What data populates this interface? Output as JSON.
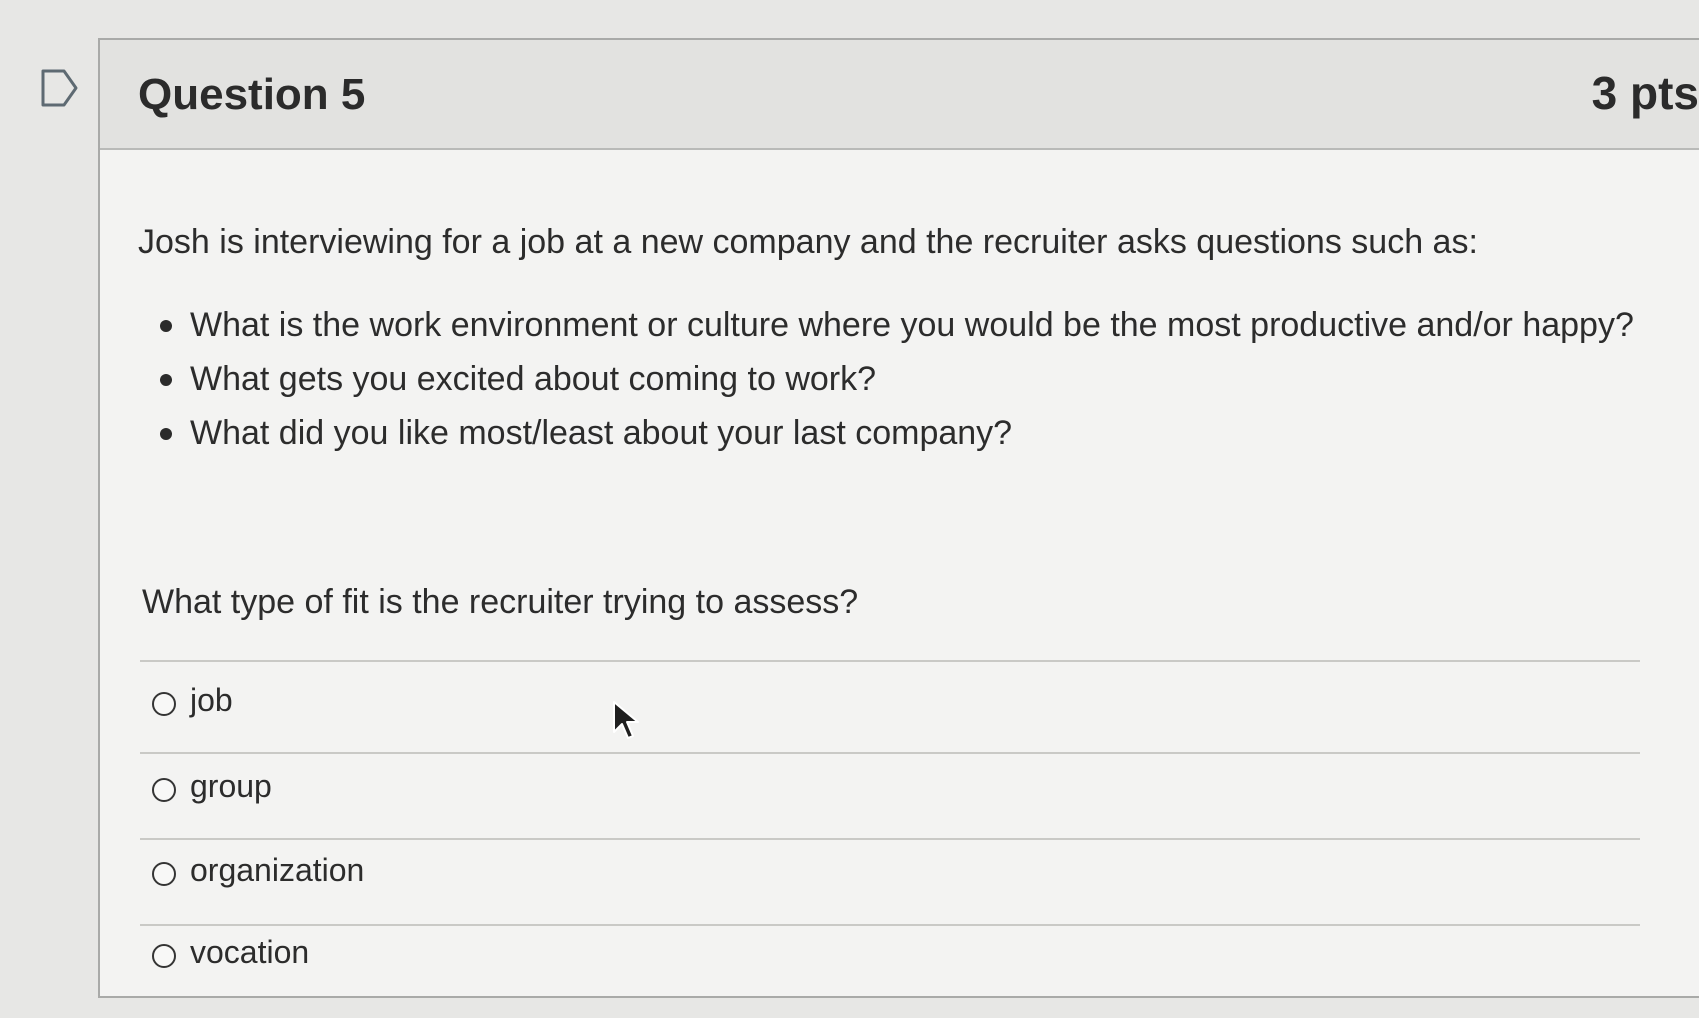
{
  "question": {
    "title": "Question 5",
    "points": "3 pts",
    "intro": "Josh is interviewing for a job at a new company and the recruiter asks questions such as:",
    "examples": [
      "What is the work environment or culture where you would be the most productive and/or happy?",
      "What gets you excited about coming to work?",
      "What did you like most/least about your last company?"
    ],
    "ask": "What type of fit is the recruiter trying to assess?",
    "answers": [
      "job",
      "group",
      "organization",
      "vocation"
    ]
  }
}
